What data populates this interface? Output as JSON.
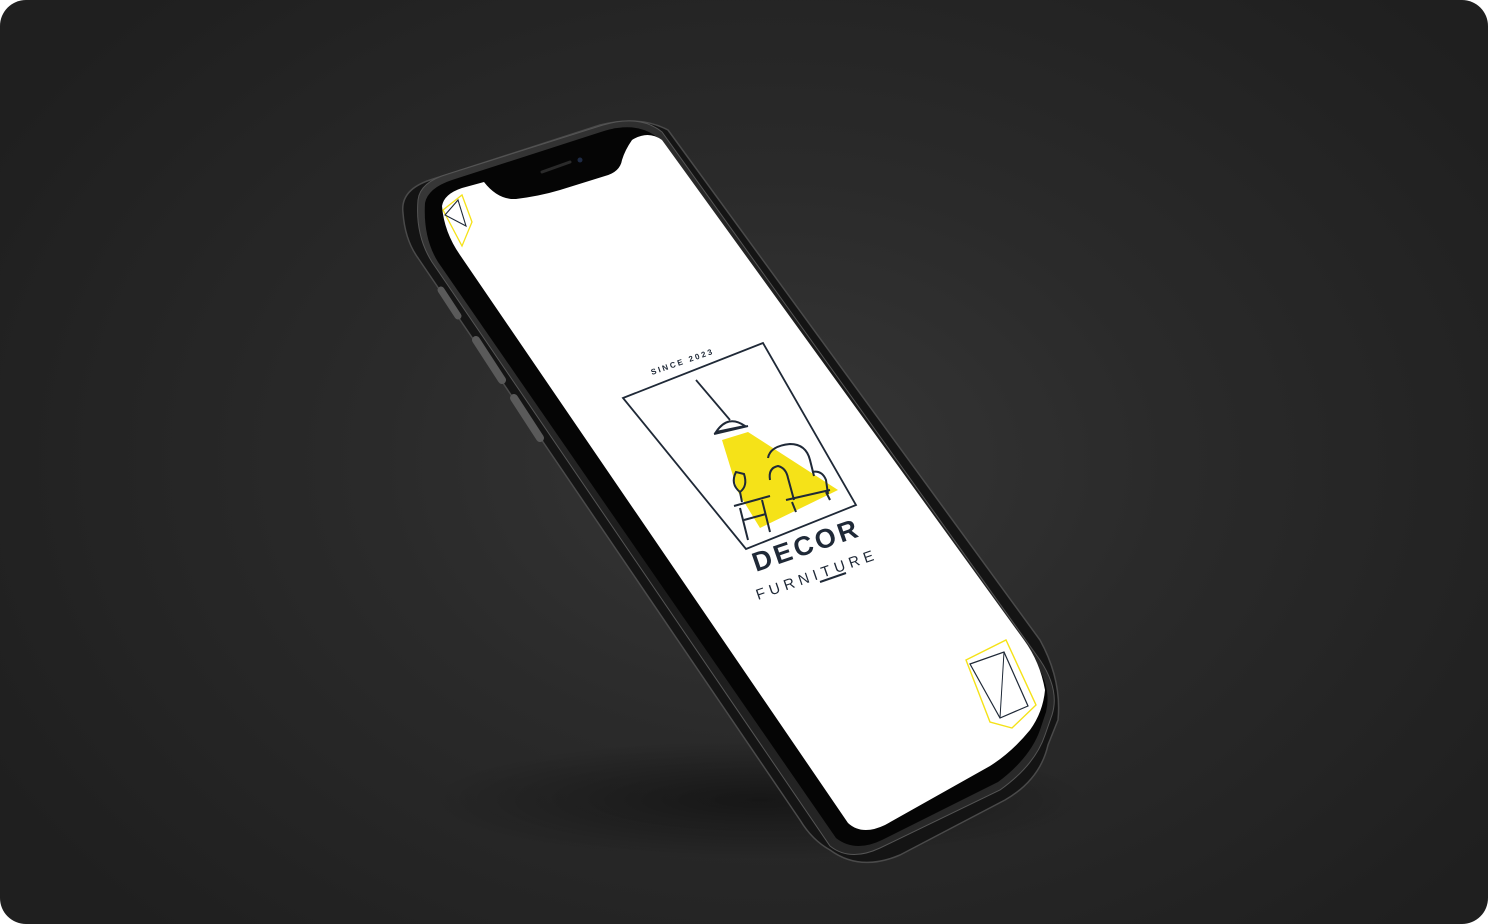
{
  "mockup": {
    "background_color": "#2b2b2b",
    "device_color": "#1c1c1c",
    "accent_color": "#f5e218",
    "ink_color": "#1f2937"
  },
  "splash": {
    "since_text": "SINCE 2023",
    "brand_name": "DECOR",
    "brand_subtitle": "FURNITURE"
  }
}
